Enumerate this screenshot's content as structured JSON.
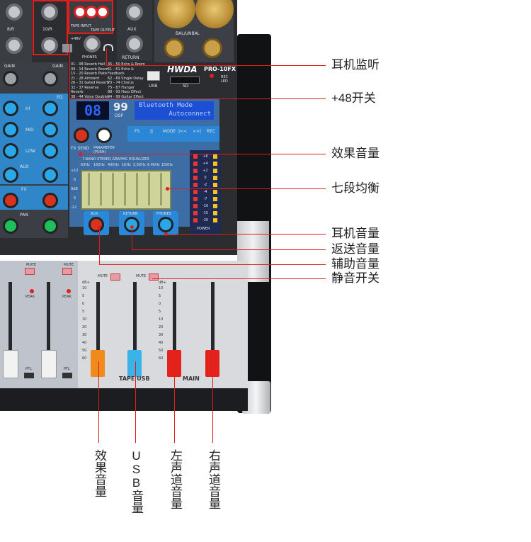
{
  "mixer": {
    "brand": "HWDA",
    "model": "PRO-10FX",
    "bal_unbal": "BAL/UNBAL",
    "usb": "USB",
    "sd": "SD",
    "rec_led": "REC LED",
    "channel_labels": [
      "8/R",
      "10/R"
    ],
    "gain": "GAIN",
    "eq": "EQ",
    "hi": "HI",
    "mid": "MID",
    "low": "LOW",
    "aux": "AUX",
    "fx": "FX",
    "pan": "PAN",
    "tape_input": "TAPE INPUT",
    "tape_output": "TAPE OUTPUT",
    "phones": "PHONES",
    "phantom": "+48V",
    "return": "RETURN",
    "seg_display": "08",
    "dsp_number": "99",
    "dsp": "DSP",
    "lcd_line1": "Bluetooth Mode",
    "lcd_line2": "Autoconnect",
    "fx_send": "FX SEND",
    "parameter": "PARAMETER (PUSH)",
    "eq_title": "7-BAND STEREO GRAPHIC EQUALIZER",
    "eq_freqs": [
      "63Hz",
      "160Hz",
      "400Hz",
      "1KHz",
      "2.5KHz",
      "6.4KHz",
      "15KHz"
    ],
    "eq_scale": [
      "+12",
      "6",
      "0dB",
      "6",
      "-12"
    ],
    "meter_scale": [
      "+6",
      "+4",
      "+2",
      "0",
      "-2",
      "-4",
      "-7",
      "-10",
      "-15",
      "-20"
    ],
    "power": "POWER",
    "transport": [
      "FS",
      "||",
      "MODE",
      "|<<",
      ">>|",
      "REC"
    ],
    "knob_aux": "AUX",
    "knob_return": "RETURN",
    "knob_phones": "PHONES",
    "mute": "MUTE",
    "peak": "PEAK",
    "pfl": "PFL",
    "db_plus": "dB+",
    "fader_scale": [
      "10",
      "5",
      "0",
      "5",
      "10",
      "20",
      "30",
      "40",
      "50",
      "60"
    ],
    "tape_usb": "TAPE USB",
    "main": "MAIN"
  },
  "effects_list": [
    "01 - 08 Reverb Hall",
    "09 - 14 Reverb Room",
    "15 - 20 Reverb Plate",
    "21 - 28 Ambient",
    "26 - 31 Gated Reverb",
    "32 - 37 Reverse Reverb",
    "38 - 44 Voice Doubler",
    "45 - 50 Echo & Room",
    "51 - 61 Echo & Feedback",
    "62 - 69 Single Delay",
    "70 - 74 Chorus",
    "75 - 87 Flanger",
    "88 - 93 Harp Effect",
    "94 - 99 Guitar Effect"
  ],
  "callouts_right": [
    {
      "text": "耳机监听"
    },
    {
      "text": "+48开关"
    },
    {
      "text": "效果音量"
    },
    {
      "text": "七段均衡"
    },
    {
      "text": "耳机音量"
    },
    {
      "text": "返送音量"
    },
    {
      "text": "辅助音量"
    },
    {
      "text": "静音开关"
    }
  ],
  "callouts_bottom": [
    {
      "text": "效果音量"
    },
    {
      "text": "USB音量"
    },
    {
      "text": "左声道音量"
    },
    {
      "text": "右声道音量"
    }
  ],
  "colors": {
    "callout_line": "#e31c1c",
    "fader_orange": "#f08a1c",
    "fader_blue": "#39b3e8",
    "fader_red": "#e4221c",
    "fader_white": "#f2f2f2"
  }
}
